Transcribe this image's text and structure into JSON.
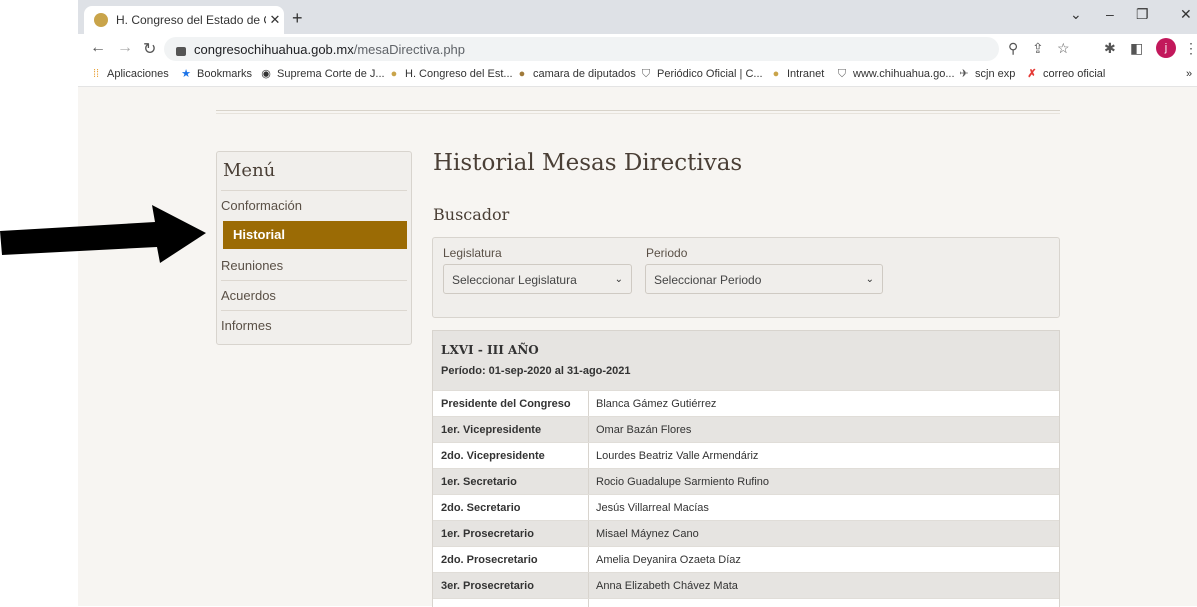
{
  "browser": {
    "tab_title": "H. Congreso del Estado de Chihu",
    "url_host": "congresochihuahua.gob.mx",
    "url_path": "/mesaDirectiva.php",
    "profile_initial": "j"
  },
  "bookmarks": [
    {
      "label": "Aplicaciones",
      "icon": "apps-grid-icon"
    },
    {
      "label": "Bookmarks",
      "icon": "star-icon"
    },
    {
      "label": "Suprema Corte de J...",
      "icon": "globe-icon"
    },
    {
      "label": "H. Congreso del Est...",
      "icon": "congress-icon"
    },
    {
      "label": "camara de diputados",
      "icon": "camara-icon"
    },
    {
      "label": "Periódico Oficial | C...",
      "icon": "shield-icon"
    },
    {
      "label": "Intranet",
      "icon": "congress-icon"
    },
    {
      "label": "www.chihuahua.go...",
      "icon": "shield-icon"
    },
    {
      "label": "scjn exp",
      "icon": "scjn-icon"
    },
    {
      "label": "correo oficial",
      "icon": "x-mark-icon"
    }
  ],
  "menu": {
    "title": "Menú",
    "items": [
      "Conformación",
      "Historial",
      "Reuniones",
      "Acuerdos",
      "Informes"
    ],
    "active": "Historial"
  },
  "main": {
    "title": "Historial Mesas Directivas",
    "subtitle": "Buscador",
    "search": {
      "legislatura_label": "Legislatura",
      "legislatura_value": "Seleccionar Legislatura",
      "periodo_label": "Periodo",
      "periodo_value": "Seleccionar Periodo"
    },
    "card": {
      "legislatura": "LXVI - III AÑO",
      "periodo": "Período: 01-sep-2020 al 31-ago-2021",
      "rows": [
        {
          "cargo": "Presidente del Congreso",
          "nombre": "Blanca Gámez Gutiérrez"
        },
        {
          "cargo": "1er. Vicepresidente",
          "nombre": "Omar Bazán Flores"
        },
        {
          "cargo": "2do. Vicepresidente",
          "nombre": "Lourdes Beatriz Valle Armendáriz"
        },
        {
          "cargo": "1er. Secretario",
          "nombre": "Rocio Guadalupe Sarmiento Rufino"
        },
        {
          "cargo": "2do. Secretario",
          "nombre": "Jesús Villarreal Macías"
        },
        {
          "cargo": "1er. Prosecretario",
          "nombre": "Misael Máynez Cano"
        },
        {
          "cargo": "2do. Prosecretario",
          "nombre": "Amelia Deyanira Ozaeta Díaz"
        },
        {
          "cargo": "3er. Prosecretario",
          "nombre": "Anna Elizabeth Chávez Mata"
        }
      ]
    }
  },
  "colors": {
    "accent": "#9b6b05",
    "page_bg": "#f7f5f2",
    "row_alt": "#e6e4e1"
  }
}
